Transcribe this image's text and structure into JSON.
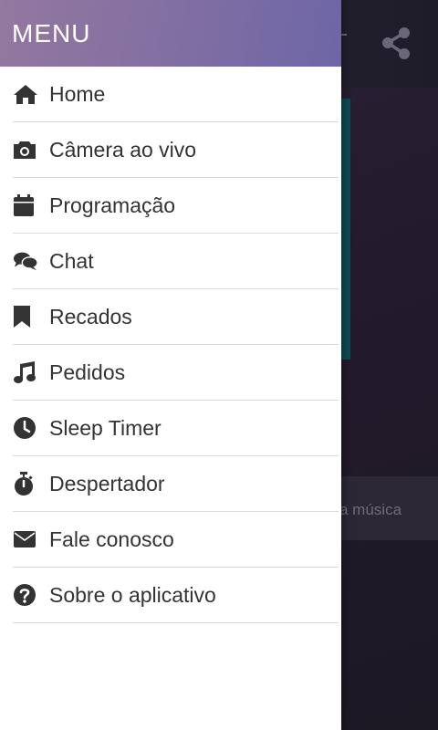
{
  "drawer": {
    "title": "MENU",
    "items": [
      {
        "label": "Home",
        "icon": "home-icon"
      },
      {
        "label": "Câmera ao vivo",
        "icon": "camera-icon"
      },
      {
        "label": "Programação",
        "icon": "calendar-icon"
      },
      {
        "label": "Chat",
        "icon": "chat-icon"
      },
      {
        "label": "Recados",
        "icon": "bookmark-icon"
      },
      {
        "label": "Pedidos",
        "icon": "music-icon"
      },
      {
        "label": "Sleep Timer",
        "icon": "clock-icon"
      },
      {
        "label": "Despertador",
        "icon": "stopwatch-icon"
      },
      {
        "label": "Fale conosco",
        "icon": "envelope-icon"
      },
      {
        "label": "Sobre o aplicativo",
        "icon": "question-icon"
      }
    ]
  },
  "background": {
    "track_text": "a música",
    "share_icon": "share-icon"
  },
  "colors": {
    "header_start": "#93789f",
    "header_end": "#6d66a6",
    "icon": "#333333",
    "divider": "#d9d9d9"
  }
}
